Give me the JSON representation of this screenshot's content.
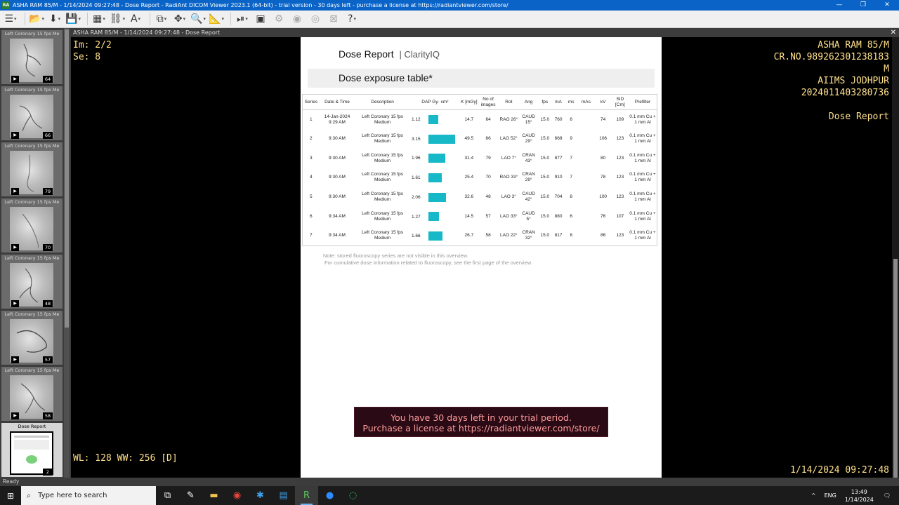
{
  "window": {
    "title": "ASHA RAM 85/M - 1/14/2024 09:27:48 - Dose Report - RadiAnt DICOM Viewer 2023.1 (64-bit) - trial version - 30 days left - purchase a license at https://radiantviewer.com/store/",
    "app_icon": "RA"
  },
  "viewer": {
    "header": "ASHA RAM 85/M - 1/14/2024 09:27:48 - Dose Report",
    "overlay_tl": [
      "Im: 2/2",
      "Se: 8"
    ],
    "overlay_tr": [
      "ASHA RAM 85/M",
      "CR.NO.989262301238183",
      "M",
      "AIIMS JODHPUR",
      "2024011403280736",
      "",
      "Dose Report"
    ],
    "overlay_bl": "WL: 128 WW: 256 [D]",
    "overlay_br": "1/14/2024 09:27:48"
  },
  "series": [
    {
      "caption": "Left Coronary 15 fps Me",
      "count": "64"
    },
    {
      "caption": "Left Coronary 15 fps Me",
      "count": "66"
    },
    {
      "caption": "Left Coronary 15 fps Me",
      "count": "79"
    },
    {
      "caption": "Left Coronary 15 fps Me",
      "count": "70"
    },
    {
      "caption": "Left Coronary 15 fps Me",
      "count": "48"
    },
    {
      "caption": "Left Coronary 15 fps Me",
      "count": "57"
    },
    {
      "caption": "Left Coronary 15 fps Me",
      "count": "58"
    },
    {
      "caption": "Dose Report",
      "count": "2"
    }
  ],
  "report": {
    "title": "Dose Report",
    "brand": "| ClarityIQ",
    "section": "Dose exposure table*",
    "headers": [
      "Series",
      "Date & Time",
      "Description",
      "DAP Gy· cm²",
      "K [mGy]",
      "No of images",
      "Rot",
      "Ang",
      "fps",
      "mA",
      "ms",
      "mAs",
      "kV",
      "SID [Cm]",
      "Prefilter"
    ],
    "rows": [
      {
        "series": "1",
        "dt": "14-Jan-2024 9:29 AM",
        "desc": "Left Coronary 15 fps Medium",
        "dap": 1.12,
        "k": "14.7",
        "img": "64",
        "rot": "RAO 26°",
        "ang": "CAUD 15°",
        "fps": "15.0",
        "ma": "760",
        "ms": "6",
        "mas": "",
        "kv": "74",
        "sid": "109",
        "pf": "0.1 mm Cu + 1 mm Al"
      },
      {
        "series": "2",
        "dt": "9:30 AM",
        "desc": "Left Coronary 15 fps Medium",
        "dap": 3.15,
        "k": "49.5",
        "img": "66",
        "rot": "LAO 52°",
        "ang": "CAUD 29°",
        "fps": "15.0",
        "ma": "668",
        "ms": "9",
        "mas": "",
        "kv": "106",
        "sid": "123",
        "pf": "0.1 mm Cu + 1 mm Al"
      },
      {
        "series": "3",
        "dt": "9:30 AM",
        "desc": "Left Coronary 15 fps Medium",
        "dap": 1.96,
        "k": "31.4",
        "img": "79",
        "rot": "LAO 7°",
        "ang": "CRAN 43°",
        "fps": "15.0",
        "ma": "877",
        "ms": "7",
        "mas": "",
        "kv": "80",
        "sid": "123",
        "pf": "0.1 mm Cu + 1 mm Al"
      },
      {
        "series": "4",
        "dt": "9:30 AM",
        "desc": "Left Coronary 15 fps Medium",
        "dap": 1.61,
        "k": "25.4",
        "img": "70",
        "rot": "RAO 33°",
        "ang": "CRAN 29°",
        "fps": "15.0",
        "ma": "910",
        "ms": "7",
        "mas": "",
        "kv": "78",
        "sid": "123",
        "pf": "0.1 mm Cu + 1 mm Al"
      },
      {
        "series": "5",
        "dt": "9:30 AM",
        "desc": "Left Coronary 15 fps Medium",
        "dap": 2.06,
        "k": "32.6",
        "img": "48",
        "rot": "LAO 3°",
        "ang": "CAUD 42°",
        "fps": "15.0",
        "ma": "704",
        "ms": "8",
        "mas": "",
        "kv": "100",
        "sid": "123",
        "pf": "0.1 mm Cu + 1 mm Al"
      },
      {
        "series": "6",
        "dt": "9:34 AM",
        "desc": "Left Coronary 15 fps Medium",
        "dap": 1.27,
        "k": "14.5",
        "img": "57",
        "rot": "LAO 33°",
        "ang": "CAUD 5°",
        "fps": "15.0",
        "ma": "880",
        "ms": "6",
        "mas": "",
        "kv": "76",
        "sid": "107",
        "pf": "0.1 mm Cu + 1 mm Al"
      },
      {
        "series": "7",
        "dt": "9:34 AM",
        "desc": "Left Coronary 15 fps Medium",
        "dap": 1.66,
        "k": "26.7",
        "img": "58",
        "rot": "LAO 22°",
        "ang": "CRAN 32°",
        "fps": "15.0",
        "ma": "817",
        "ms": "8",
        "mas": "",
        "kv": "86",
        "sid": "123",
        "pf": "0.1 mm Cu + 1 mm Al"
      }
    ],
    "note_1": "Note: stored fluoroscopy series are not visible in this overview.",
    "note_2": "For cumulative dose information related to fluoroscopy, see the first page of the overview.",
    "dap_color": "#17b8c8"
  },
  "trial": {
    "line1": "You have 30 days left in your trial period.",
    "line2": "Purchase a license at https://radiantviewer.com/store/"
  },
  "status": "Ready",
  "taskbar": {
    "search_placeholder": "Type here to search",
    "lang": "ENG",
    "time": "13:49",
    "date": "1/14/2024"
  }
}
